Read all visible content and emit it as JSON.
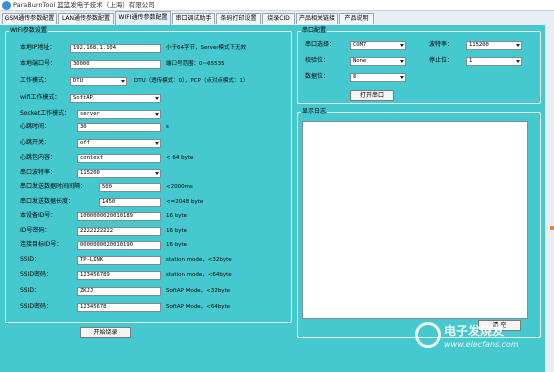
{
  "window": {
    "title": "ParaBurnTool   篮篮发电子技术（上海）有限公司"
  },
  "tabs": [
    {
      "label": "GSM通传参数配置"
    },
    {
      "label": "LAN通传参数配置"
    },
    {
      "label": "WIFI通传参数配置"
    },
    {
      "label": "串口调试助手"
    },
    {
      "label": "条码打印设置"
    },
    {
      "label": "烧录CID"
    },
    {
      "label": "产品相关链接"
    },
    {
      "label": "产品说明"
    }
  ],
  "wifi": {
    "legend": "WIFI参数设置",
    "local_ip": {
      "label": "本地IP地址：",
      "value": "192.168.1.104",
      "note": "小于64字节，Server模式下无效"
    },
    "local_port": {
      "label": "本地端口号：",
      "value": "30000",
      "note": "端口号范围：0~65535"
    },
    "work_mode": {
      "label": "工作模式：",
      "value": "DTU",
      "note": "DTU（透传模式：0），PCP（点对点模式：1）"
    },
    "wifi_mode": {
      "label": "wifi工作模式：",
      "value": "SoftAP"
    },
    "socket_mode": {
      "label": "Socket工作模式：",
      "value": "server"
    },
    "heartbeat_time": {
      "label": "心跳时间：",
      "value": "30",
      "note": "s"
    },
    "heartbeat_switch": {
      "label": "心跳开关：",
      "value": "off"
    },
    "heartbeat_content": {
      "label": "心跳包内容：",
      "value": "context",
      "note": "< 64 byte"
    },
    "baud": {
      "label": "串口波特率：",
      "value": "115200"
    },
    "send_timeout": {
      "label": "串口发送数据时间间隔：",
      "value": "500",
      "note": "<2000ms"
    },
    "send_len": {
      "label": "串口发送数据长度：",
      "value": "1450",
      "note": "<=2048 byte"
    },
    "device_id": {
      "label": "本设备ID号：",
      "value": "1000000020010189",
      "note": "16 byte"
    },
    "id_password": {
      "label": "ID号密码：",
      "value": "2222222222",
      "note": "16 byte"
    },
    "target_id": {
      "label": "连接目标ID号：",
      "value": "0000000020010190",
      "note": "16 byte"
    },
    "ssid1": {
      "label": "SSID：",
      "value": "TP-LINK",
      "note": "station mode，<32byte"
    },
    "ssid_pwd1": {
      "label": "SSID密码：",
      "value": "123456789",
      "note": "station mode，<64byte"
    },
    "ssid2": {
      "label": "SSID：",
      "value": "ZKJJ",
      "note": "SoftAP Mode，<32byte"
    },
    "ssid_pwd2": {
      "label": "SSID密码：",
      "value": "12345678",
      "note": "SoftAP Mode，<64byte"
    },
    "burn_button": "开始烧录"
  },
  "serial": {
    "legend": "串口配置",
    "port": {
      "label": "串口选择：",
      "value": "COM7"
    },
    "baud": {
      "label": "波特率：",
      "value": "115200"
    },
    "parity": {
      "label": "校验位：",
      "value": "None"
    },
    "stopbits": {
      "label": "停止位：",
      "value": "1"
    },
    "databits": {
      "label": "数据位：",
      "value": "8"
    },
    "open_button": "打开串口"
  },
  "log": {
    "legend": "显示日志",
    "clear_button": "清 空"
  },
  "watermark": {
    "line1": "电子发烧友",
    "line2": "www.elecfans.com"
  },
  "colors": {
    "panel": "#46c8cf",
    "background": "#d6e2ec"
  }
}
